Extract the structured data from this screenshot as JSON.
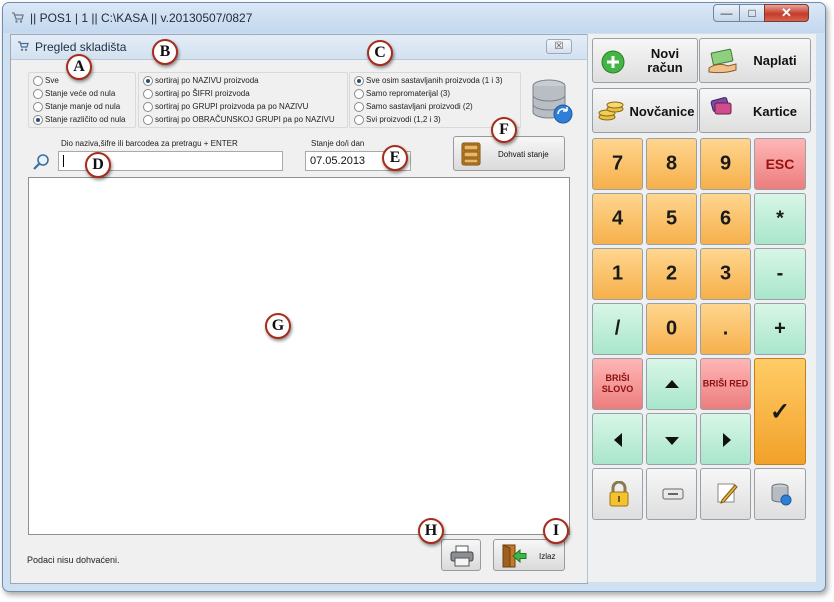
{
  "window": {
    "title": "|| POS1 | 1 || C:\\KASA || v.20130507/0827",
    "controls": {
      "minimize": "—",
      "maximize": "□",
      "close": "✕"
    }
  },
  "dialog": {
    "title": "Pregled skladišta",
    "close_label": "☒",
    "filter_group": {
      "options": [
        {
          "label": "Sve",
          "selected": false
        },
        {
          "label": "Stanje veće od nula",
          "selected": false
        },
        {
          "label": "Stanje manje od nula",
          "selected": false
        },
        {
          "label": "Stanje različito od nula",
          "selected": true
        }
      ]
    },
    "sort_group": {
      "options": [
        {
          "label": "sortiraj po NAZIVU proizvoda",
          "selected": true
        },
        {
          "label": "sortiraj po ŠIFRI proizvoda",
          "selected": false
        },
        {
          "label": "sortiraj po GRUPI proizvoda pa po NAZIVU",
          "selected": false
        },
        {
          "label": "sortiraj po OBRAČUNSKOJ GRUPI pa po NAZIVU",
          "selected": false
        }
      ]
    },
    "product_type_group": {
      "options": [
        {
          "label": "Sve osim sastavljanih proizvoda (1 i 3)",
          "selected": true
        },
        {
          "label": "Samo repromaterijal (3)",
          "selected": false
        },
        {
          "label": "Samo sastavljani proizvodi (2)",
          "selected": false
        },
        {
          "label": "Svi proizvodi (1,2 i 3)",
          "selected": false
        }
      ]
    },
    "search": {
      "label": "Dio naziva,šifre ili barcodea za pretragu + ENTER",
      "value": ""
    },
    "date": {
      "label": "Stanje do/i dan",
      "value": "07.05.2013"
    },
    "fetch_button": {
      "label": "Dohvati stanje"
    },
    "exit_button": {
      "label": "Izlaz"
    },
    "status": "Podaci nisu dohvaćeni."
  },
  "markers": [
    "A",
    "B",
    "C",
    "D",
    "E",
    "F",
    "G",
    "H",
    "I"
  ],
  "panel": {
    "novi_racun": "Novi račun",
    "naplati": "Naplati",
    "novcanice": "Novčanice",
    "kartice": "Kartice",
    "keys": {
      "seven": "7",
      "eight": "8",
      "nine": "9",
      "esc": "ESC",
      "four": "4",
      "five": "5",
      "six": "6",
      "multiply": "*",
      "one": "1",
      "two": "2",
      "three": "3",
      "minus": "-",
      "divide": "/",
      "zero": "0",
      "dot": ".",
      "plus": "+",
      "brisi_slovo": "BRIŠI SLOVO",
      "brisi_red": "BRIŠI RED",
      "confirm": "✓"
    }
  },
  "colors": {
    "title_bar": "#c3d7ee",
    "orange_key": "#f6b04b",
    "red_key": "#ec7d7d",
    "mint_key": "#a9e6cb",
    "marker_border": "#a62c1c"
  },
  "icons": [
    "app-icon",
    "warehouse-icon",
    "database-icon",
    "search-icon",
    "cabinet-icon",
    "printer-icon",
    "exit-door-icon",
    "plus-circle-icon",
    "money-hand-icon",
    "coins-icon",
    "cards-icon",
    "lock-icon",
    "cash-drawer-icon",
    "pencil-icon",
    "database-small-icon"
  ]
}
